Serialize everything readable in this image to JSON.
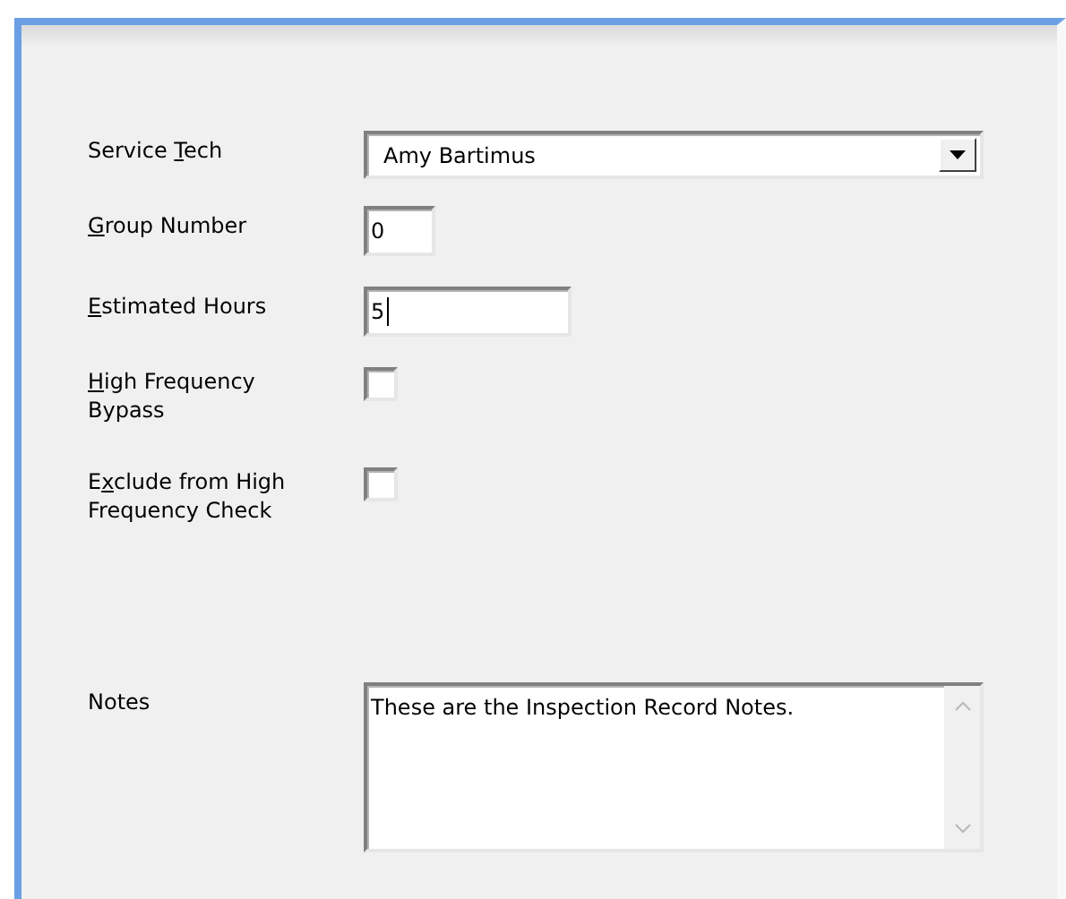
{
  "fields": [
    {
      "kind": "combo",
      "label": {
        "before": "Service ",
        "key": "T",
        "after": "ech"
      },
      "value": "Amy Bartimus"
    },
    {
      "kind": "text",
      "label": {
        "key": "G",
        "after": "roup Number"
      },
      "value": "0",
      "focused": false
    },
    {
      "kind": "text",
      "label": {
        "key": "E",
        "after": "stimated Hours"
      },
      "value": "5",
      "focused": true
    },
    {
      "kind": "checkbox",
      "label": {
        "key": "H",
        "after": "igh Frequency Bypass"
      },
      "checked": false
    },
    {
      "kind": "checkbox",
      "label": {
        "before": "E",
        "key": "x",
        "after": "clude from High Frequency Check"
      },
      "checked": false
    },
    {
      "kind": "memo",
      "label": {
        "after": "Notes"
      },
      "value": "These are the Inspection Record Notes."
    }
  ]
}
